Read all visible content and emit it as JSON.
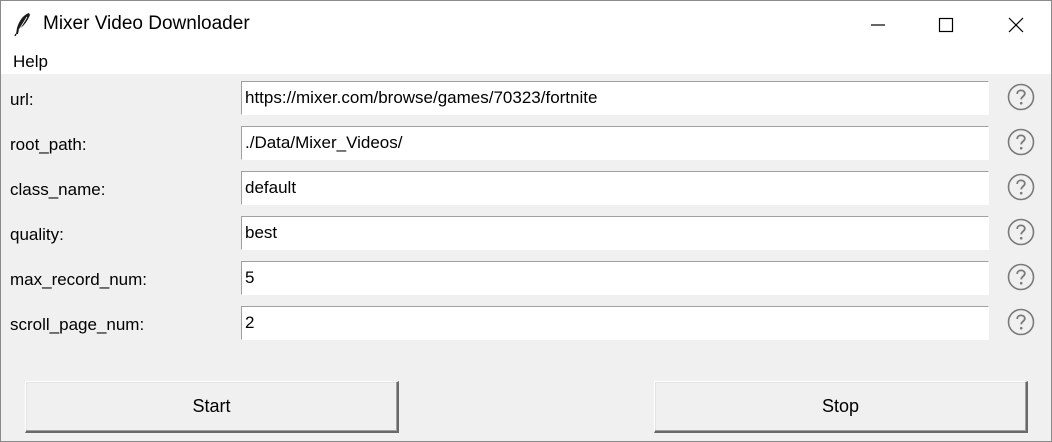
{
  "window": {
    "title": "Mixer Video Downloader",
    "icon": "feather-icon"
  },
  "menu": {
    "items": [
      "Help"
    ]
  },
  "form": {
    "rows": [
      {
        "label": "url:",
        "value": "https://mixer.com/browse/games/70323/fortnite"
      },
      {
        "label": "root_path:",
        "value": "./Data/Mixer_Videos/"
      },
      {
        "label": "class_name:",
        "value": "default"
      },
      {
        "label": "quality:",
        "value": "best"
      },
      {
        "label": "max_record_num:",
        "value": "5"
      },
      {
        "label": "scroll_page_num:",
        "value": "2"
      }
    ],
    "help_icon": "question-circle-icon"
  },
  "buttons": {
    "start_label": "Start",
    "stop_label": "Stop"
  },
  "colors": {
    "background": "#f0f0f0",
    "titlebar": "#ffffff",
    "input_bg": "#ffffff",
    "help_icon": "#7a7a7a"
  }
}
